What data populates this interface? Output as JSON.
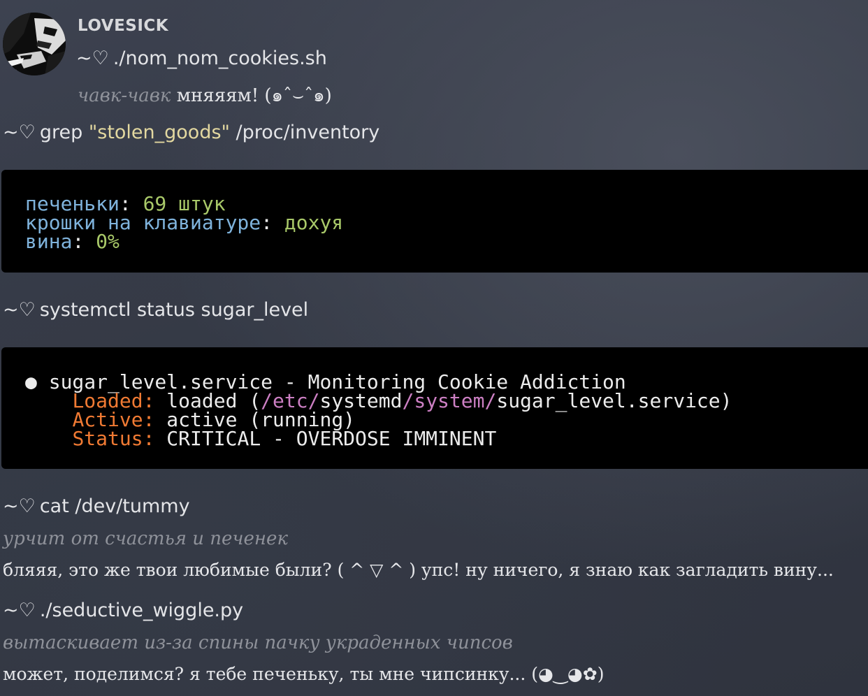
{
  "header": {
    "username": "LOVESICK",
    "command": "./nom_nom_cookies.sh",
    "action_italic": "чавк-чавк",
    "action_text": " мняяям! (๑ˆ⌣ˆ๑)"
  },
  "prompt_symbol": "~♡",
  "command1": {
    "cmd": "grep",
    "arg": "\"stolen_goods\"",
    "path": "/proc/inventory"
  },
  "inventory": {
    "lines": [
      {
        "key": "печеньки",
        "sep": ": ",
        "value": "69 штук"
      },
      {
        "key": "крошки на клавиатуре",
        "sep": ": ",
        "value": "дохуя"
      },
      {
        "key": "вина",
        "sep": ": ",
        "value": "0%"
      }
    ]
  },
  "command2": {
    "text": "systemctl status sugar_level"
  },
  "status": {
    "bullet": "●",
    "title": " sugar_level.service - Monitoring Cookie Addiction",
    "loaded_label": "Loaded:",
    "loaded_pre": " loaded (",
    "loaded_p1": "/etc/",
    "loaded_p2": "systemd",
    "loaded_p3": "/system/",
    "loaded_p4": "sugar_level.service)",
    "active_label": "Active:",
    "active_value": " active (running)",
    "status_label": "Status:",
    "status_value": " CRITICAL - OVERDOSE IMMINENT"
  },
  "command3": {
    "text": "cat /dev/tummy",
    "italic": "урчит от счастья и печенек",
    "text_line": "бляяя, это же твои любимые были? ( ^ ▽ ^ ) упс! ну ничего, я знаю как загладить вину..."
  },
  "command4": {
    "text": "./seductive_wiggle.py",
    "italic": "вытаскивает из-за спины пачку украденных чипсов",
    "text_line": "может, поделимся? я тебе печеньку, ты мне чипсинку... (◕‿◕✿)"
  },
  "colors": {
    "string_yellow": "#e3d8a0",
    "key_blue": "#7fb3dc",
    "value_green": "#a9c969",
    "label_orange": "#f07a33",
    "path_magenta": "#cc7fc3"
  }
}
